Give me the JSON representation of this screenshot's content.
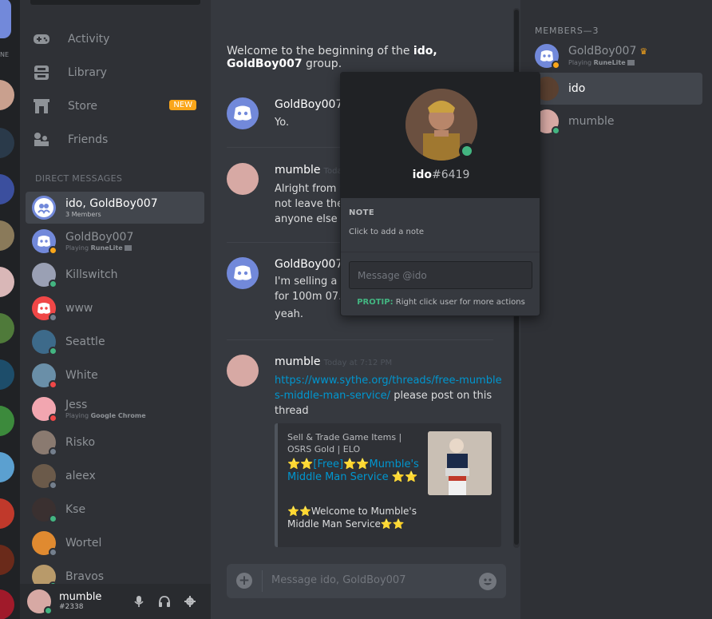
{
  "nav": {
    "activity": "Activity",
    "library": "Library",
    "store": "Store",
    "new_badge": "NEW",
    "friends": "Friends"
  },
  "guilds": {
    "online_label": "NE"
  },
  "direct_messages": {
    "header": "DIRECT MESSAGES",
    "items": [
      {
        "name": "ido, GoldBoy007",
        "sub": "3 Members",
        "status": "",
        "selected": true
      },
      {
        "name": "GoldBoy007",
        "sub_prefix": "Playing ",
        "sub_game": "RuneLite",
        "status": "idle"
      },
      {
        "name": "Killswitch",
        "status": "online"
      },
      {
        "name": "www",
        "status": "offline"
      },
      {
        "name": "Seattle",
        "status": "online"
      },
      {
        "name": "White",
        "status": "dnd"
      },
      {
        "name": "Jess",
        "sub_prefix": "Playing ",
        "sub_game": "Google Chrome",
        "status": "dnd"
      },
      {
        "name": "Risko",
        "status": "offline"
      },
      {
        "name": "aleex",
        "status": "offline"
      },
      {
        "name": "Kse",
        "status": "online"
      },
      {
        "name": "Wortel",
        "status": "offline"
      },
      {
        "name": "Bravos",
        "status": "online"
      }
    ]
  },
  "user": {
    "name": "mumble",
    "tag": "#2338"
  },
  "chat": {
    "welcome_prefix": "Welcome to the beginning of the ",
    "welcome_group": "ido, GoldBoy007",
    "welcome_suffix": " group.",
    "messages": [
      {
        "author": "GoldBoy007",
        "time": "",
        "lines": [
          "Yo."
        ]
      },
      {
        "author": "mumble",
        "time": "Toda",
        "lines": [
          "Alright from t",
          "not leave the",
          "anyone else t"
        ]
      },
      {
        "author": "GoldBoy007",
        "time": "",
        "lines": [
          "I'm selling a s",
          "for 100m 07.",
          "yeah."
        ]
      },
      {
        "author": "mumble",
        "time": "Today at 7:12 PM",
        "link": "https://www.sythe.org/threads/free-mumbles-middle-man-service/",
        "after_link": " please post on this thread"
      }
    ],
    "embed": {
      "provider": "Sell & Trade Game Items | OSRS Gold | ELO",
      "title": "⭐⭐[Free]⭐⭐Mumble's Middle Man Service ⭐⭐",
      "description": "⭐⭐Welcome to Mumble's Middle Man Service⭐⭐"
    },
    "input_placeholder": "Message ido, GoldBoy007"
  },
  "members": {
    "header": "MEMBERS—3",
    "items": [
      {
        "name": "GoldBoy007",
        "sub_prefix": "Playing ",
        "sub_game": "RuneLite",
        "status": "idle",
        "owner": true
      },
      {
        "name": "ido",
        "status": "",
        "selected": true
      },
      {
        "name": "mumble",
        "status": "online"
      }
    ]
  },
  "popout": {
    "username": "ido",
    "discriminator": "#6419",
    "note_header": "NOTE",
    "note_placeholder": "Click to add a note",
    "message_placeholder": "Message @ido",
    "protip_label": "PROTIP:",
    "protip_text": " Right click user for more actions"
  },
  "colors": {
    "blurple": "#7289da",
    "online": "#43b581",
    "idle": "#faa61a",
    "dnd": "#f04747",
    "offline": "#747f8d",
    "link": "#0096cf"
  }
}
